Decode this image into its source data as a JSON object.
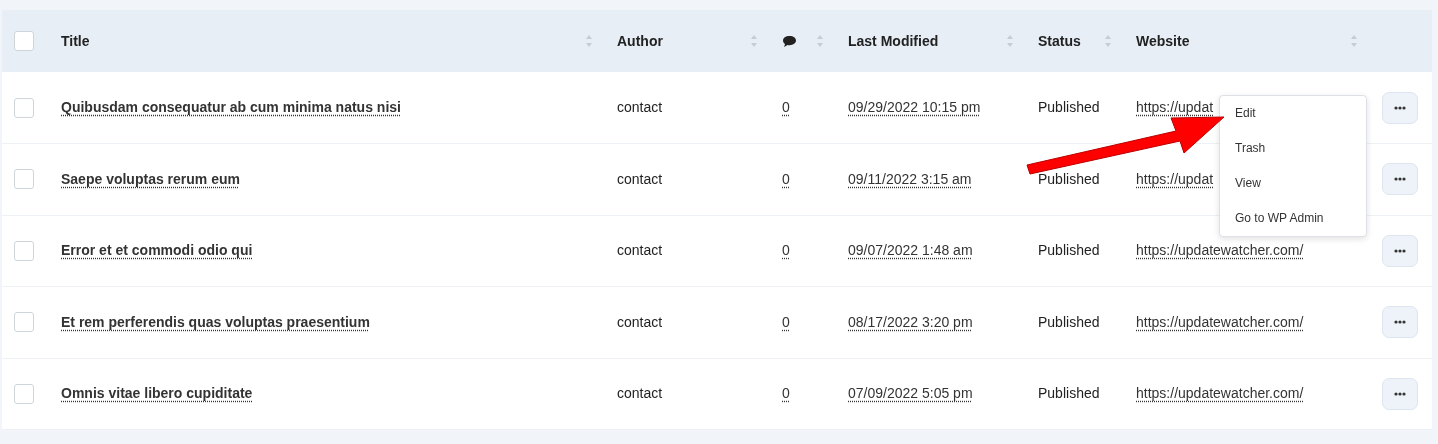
{
  "table": {
    "select_all": {
      "checked": false
    },
    "columns": [
      {
        "kind": "text",
        "label": "Title",
        "sortable": true
      },
      {
        "kind": "text",
        "label": "Author",
        "sortable": true
      },
      {
        "kind": "comments-icon",
        "sortable": true
      },
      {
        "kind": "text",
        "label": "Last Modified",
        "sortable": true
      },
      {
        "kind": "text",
        "label": "Status",
        "sortable": true
      },
      {
        "kind": "text",
        "label": "Website",
        "sortable": true
      }
    ],
    "rows": [
      {
        "checked": false,
        "title": "Quibusdam consequatur ab cum minima natus nisi",
        "author": "contact",
        "comments": "0",
        "last_modified": "09/29/2022 10:15 pm",
        "status": "Published",
        "website": "https://updat"
      },
      {
        "checked": false,
        "title": "Saepe voluptas rerum eum",
        "author": "contact",
        "comments": "0",
        "last_modified": "09/11/2022 3:15 am",
        "status": "Published",
        "website": "https://updat"
      },
      {
        "checked": false,
        "title": "Error et et commodi odio qui",
        "author": "contact",
        "comments": "0",
        "last_modified": "09/07/2022 1:48 am",
        "status": "Published",
        "website": "https://updatewatcher.com/"
      },
      {
        "checked": false,
        "title": "Et rem perferendis quas voluptas praesentium",
        "author": "contact",
        "comments": "0",
        "last_modified": "08/17/2022 3:20 pm",
        "status": "Published",
        "website": "https://updatewatcher.com/"
      },
      {
        "checked": false,
        "title": "Omnis vitae libero cupiditate",
        "author": "contact",
        "comments": "0",
        "last_modified": "07/09/2022 5:05 pm",
        "status": "Published",
        "website": "https://updatewatcher.com/"
      }
    ]
  },
  "row_menu": {
    "items": [
      "Edit",
      "Trash",
      "View",
      "Go to WP Admin"
    ]
  }
}
